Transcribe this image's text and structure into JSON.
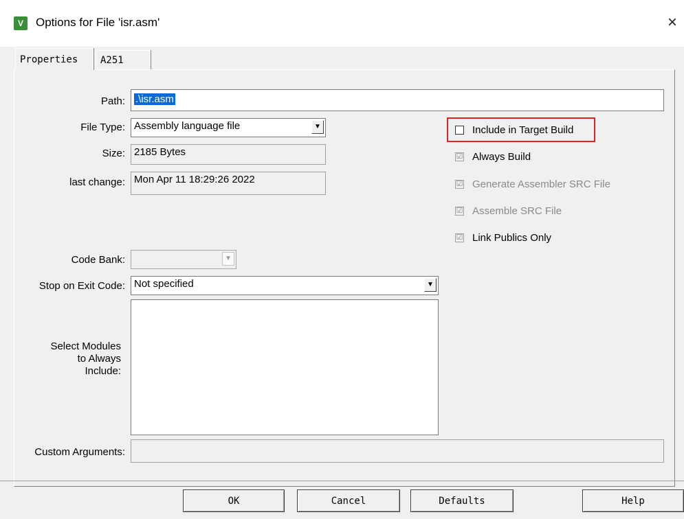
{
  "window": {
    "title": "Options for File 'isr.asm'",
    "app_icon": "uvision-icon",
    "close_glyph": "×"
  },
  "tabs": [
    {
      "label": "Properties",
      "active": true
    },
    {
      "label": "A251",
      "active": false
    }
  ],
  "form": {
    "path_label": "Path:",
    "path_value": ".\\isr.asm",
    "file_type_label": "File Type:",
    "file_type_value": "Assembly language file",
    "size_label": "Size:",
    "size_value": "2185 Bytes",
    "last_change_label": "last change:",
    "last_change_value": "Mon Apr 11 18:29:26 2022",
    "code_bank_label": "Code Bank:",
    "code_bank_value": "",
    "stop_on_exit_label": "Stop on Exit Code:",
    "stop_on_exit_value": "Not specified",
    "modules_label_line1": "Select Modules",
    "modules_label_line2": "to Always",
    "modules_label_line3": "Include:",
    "custom_args_label": "Custom Arguments:",
    "custom_args_value": ""
  },
  "options": {
    "include_in_target_build": {
      "label": "Include in Target Build",
      "checked": false
    },
    "always_build": {
      "label": "Always Build",
      "checked": true
    },
    "generate_src": {
      "label": "Generate Assembler SRC File",
      "checked": true
    },
    "assemble_src": {
      "label": "Assemble SRC File",
      "checked": true
    },
    "link_publics_only": {
      "label": "Link Publics Only",
      "checked": true
    }
  },
  "buttons": {
    "ok": "OK",
    "cancel": "Cancel",
    "defaults": "Defaults",
    "help": "Help"
  },
  "colors": {
    "highlight_box": "#e02424",
    "selection": "#0a6ad6"
  },
  "check_glyph": "☑",
  "combo_arrow": "▼"
}
